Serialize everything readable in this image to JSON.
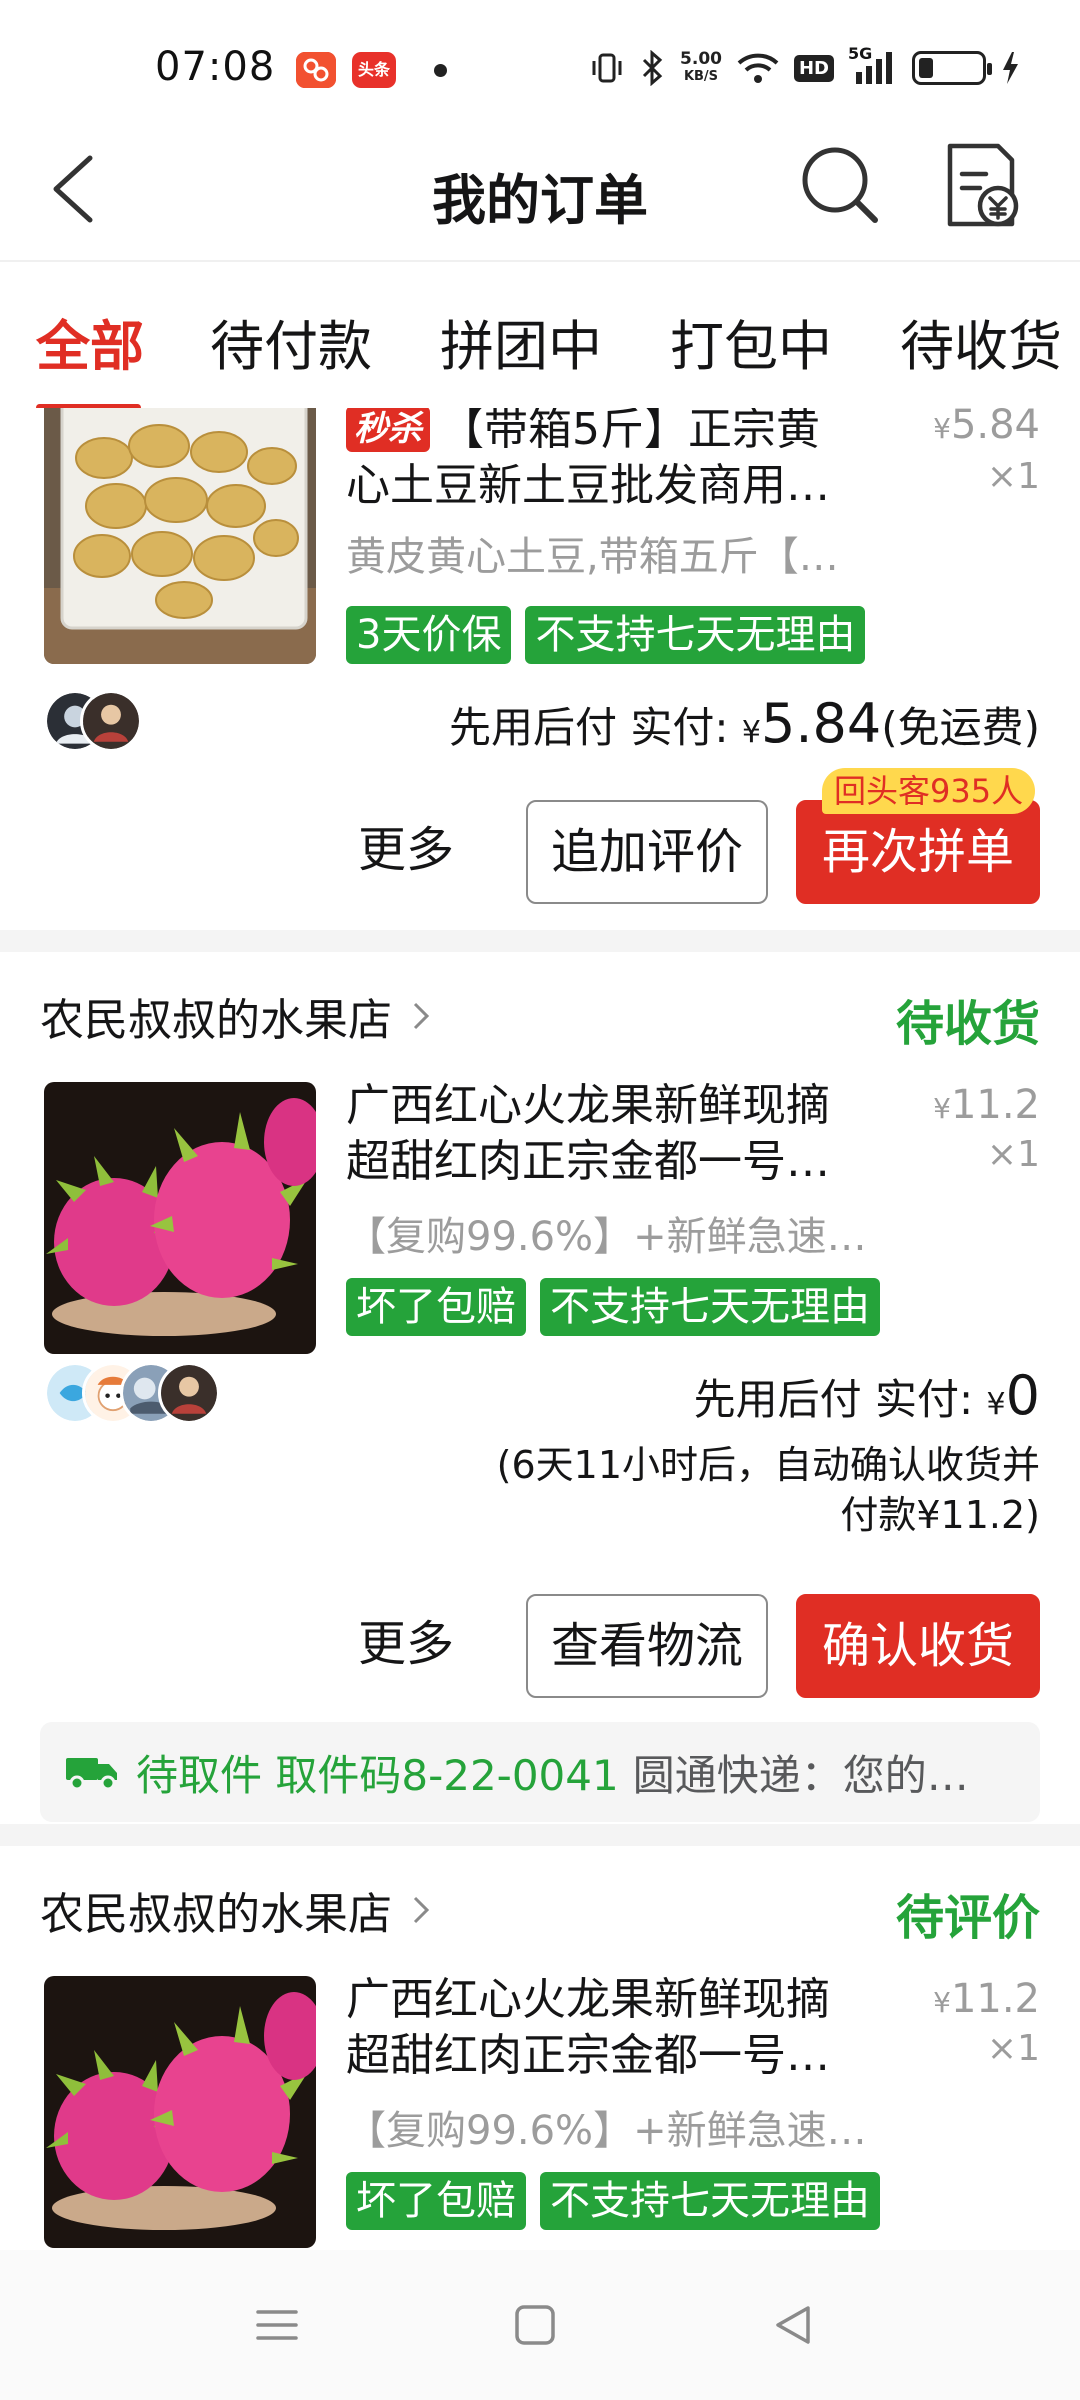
{
  "status_bar": {
    "time": "07:08",
    "app1_label": "拼多多",
    "app2_label": "头条",
    "net_speed_value": "5.00",
    "net_speed_unit": "KB/S",
    "hd_label": "HD",
    "signal_label": "5G"
  },
  "nav": {
    "title": "我的订单"
  },
  "tabs": [
    {
      "label": "全部",
      "active": true
    },
    {
      "label": "待付款",
      "active": false
    },
    {
      "label": "拼团中",
      "active": false
    },
    {
      "label": "打包中",
      "active": false
    },
    {
      "label": "待收货",
      "active": false
    }
  ],
  "orders": [
    {
      "flash_tag": "秒杀",
      "title_line1": "【带箱5斤】正宗黄",
      "title_line2": "心土豆新土豆批发商用…",
      "spec": "黄皮黄心土豆,带箱五斤【…",
      "price_symbol": "¥",
      "price": "5.84",
      "qty": "×1",
      "tags": [
        "3天价保",
        "不支持七天无理由"
      ],
      "pay_label": "先用后付 实付:",
      "pay_symbol": "¥",
      "pay_amount": "5.84",
      "pay_suffix": "(免运费)",
      "btn_more": "更多",
      "btn_secondary": "追加评价",
      "btn_primary": "再次拼单",
      "badge": "回头客935人"
    },
    {
      "shop": "农民叔叔的水果店",
      "status": "待收货",
      "title_line1": "广西红心火龙果新鲜现摘",
      "title_line2": "超甜红肉正宗金都一号…",
      "spec": "【复购99.6%】+新鲜急速…",
      "price_symbol": "¥",
      "price": "11.2",
      "qty": "×1",
      "tags": [
        "坏了包赔",
        "不支持七天无理由"
      ],
      "pay_label": "先用后付 实付:",
      "pay_symbol": "¥",
      "pay_amount": "0",
      "note_line1": "(6天11小时后，自动确认收货并",
      "note_line2": "付款¥11.2)",
      "btn_more": "更多",
      "btn_secondary": "查看物流",
      "btn_primary": "确认收货",
      "logistics_status": "待取件 取件码8-22-0041",
      "logistics_text": "圆通快递：您的…"
    },
    {
      "shop": "农民叔叔的水果店",
      "status": "待评价",
      "title_line1": "广西红心火龙果新鲜现摘",
      "title_line2": "超甜红肉正宗金都一号…",
      "spec": "【复购99.6%】+新鲜急速…",
      "price_symbol": "¥",
      "price": "11.2",
      "qty": "×1",
      "tags": [
        "坏了包赔",
        "不支持七天无理由"
      ]
    }
  ],
  "colors": {
    "accent_red": "#e02e24",
    "green": "#25a33a",
    "badge_yellow": "#ffd84d"
  },
  "icons": {
    "back": "chevron-left-icon",
    "search": "search-icon",
    "bill": "bill-icon",
    "truck": "truck-icon",
    "menu": "menu-icon",
    "home": "home-icon",
    "back_nav": "back-triangle-icon"
  }
}
